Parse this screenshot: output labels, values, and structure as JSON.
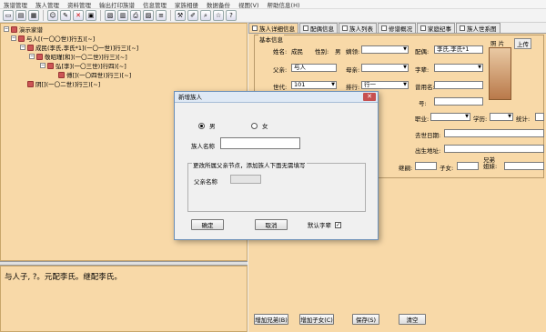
{
  "menu": [
    "族谱管理",
    "族人管理",
    "资料管理",
    "输出打印族谱",
    "信息管理",
    "家族相册",
    "数据备份",
    "视图(V)",
    "帮助信息(H)"
  ],
  "tree": {
    "root": "演示家谱",
    "nodes": [
      "与人[(一〇〇世)]行五)[~]",
      "成民(李氏,李氏*1](一〇一世)]行三)[~]",
      "敬昭瑾[和](一〇二世)]行三)[~]",
      "弘[李](一〇三世)]行四)[~]",
      "傅[](一〇四世)]行三)[~]",
      "阴[](一〇二世)]行三)[~]"
    ]
  },
  "description": "与人子, ?。元配李氏。继配李氏。",
  "tabs": [
    "族人详细信息",
    "配偶信息",
    "族人列表",
    "修谱概况",
    "家庭纪事",
    "族人世系图"
  ],
  "basic": {
    "group_title": "基本信息",
    "name_label": "姓名:",
    "name_value": "成民",
    "gender_label": "性别:",
    "gender_value": "男",
    "birth_label": "嫡领:",
    "spouse_label": "配偶:",
    "spouse_value": "李氏,李氏*1",
    "photo_label": "照 片",
    "upload_label": "上传",
    "father_label": "父亲:",
    "father_value": "与人",
    "mother_label": "母亲:",
    "zi_label": "字辈:",
    "gen_label": "世代:",
    "gen_value": "101",
    "rank_label": "排行:",
    "rank_value": "行一",
    "alias_label": "曾用名:",
    "hao_label": "号:",
    "job_label": "职业:",
    "edu_label": "学历:",
    "stat_label": "统计:",
    "death_label": "去世日期:",
    "birthplace_label": "出生地址:",
    "succ_label": "继嗣:",
    "children_label": "子女:",
    "brothers_label": "兄弟\n姐妹:"
  },
  "buttons": [
    "增加兄弟(B)",
    "增加子女(C)",
    "保存(S)",
    "清空"
  ],
  "dialog": {
    "title": "新增族人",
    "male": "男",
    "female": "女",
    "name_label": "族人名称",
    "group_title": "更改所属父亲节点，添加族人下面无需填写",
    "father_label": "父亲名称",
    "ok": "确定",
    "cancel": "取消",
    "default_zi": "默认字辈",
    "default_zi_checked": "✓"
  }
}
